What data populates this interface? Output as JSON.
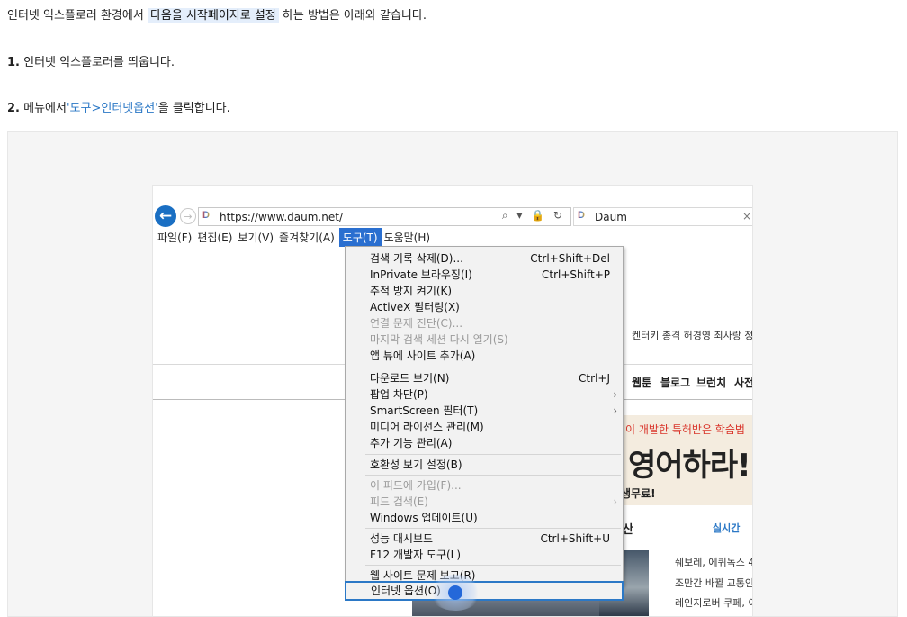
{
  "intro": {
    "before": "인터넷 익스플로러 환경에서",
    "highlight": "다음을 시작페이지로 설정",
    "after": "하는 방법은 아래와 같습니다."
  },
  "steps": [
    {
      "num": "1.",
      "text": "인터넷 익스플로러를 띄웁니다."
    },
    {
      "num": "2.",
      "text_before": "메뉴에서",
      "link": "'도구>인터넷옵션'",
      "text_after": "을 클릭합니다."
    }
  ],
  "browser": {
    "url": "https://www.daum.net/",
    "address_icons": "⌕ ▾ 🔒 ↻",
    "tab_title": "Daum",
    "tab_close": "×",
    "back_icon": "←",
    "forward_icon": "→",
    "menubar": [
      "파일(F)",
      "편집(E)",
      "보기(V)",
      "즐겨찾기(A)",
      "도구(T)",
      "도움말(H)"
    ],
    "active_menu": "도구(T)"
  },
  "tools_menu": {
    "items": [
      {
        "label": "검색 기록 삭제(D)...",
        "shortcut": "Ctrl+Shift+Del",
        "disabled": false
      },
      {
        "label": "InPrivate 브라우징(I)",
        "shortcut": "Ctrl+Shift+P",
        "disabled": false
      },
      {
        "label": "추적 방지 켜기(K)",
        "shortcut": "",
        "disabled": false
      },
      {
        "label": "ActiveX 필터링(X)",
        "shortcut": "",
        "disabled": false
      },
      {
        "label": "연결 문제 진단(C)...",
        "shortcut": "",
        "disabled": true
      },
      {
        "label": "마지막 검색 세션 다시 열기(S)",
        "shortcut": "",
        "disabled": true
      },
      {
        "label": "앱 뷰에 사이트 추가(A)",
        "shortcut": "",
        "disabled": false
      },
      {
        "label": "다운로드 보기(N)",
        "shortcut": "Ctrl+J",
        "disabled": false
      },
      {
        "label": "팝업 차단(P)",
        "shortcut": "",
        "submenu": "›",
        "disabled": false
      },
      {
        "label": "SmartScreen 필터(T)",
        "shortcut": "",
        "submenu": "›",
        "disabled": false
      },
      {
        "label": "미디어 라이선스 관리(M)",
        "shortcut": "",
        "disabled": false
      },
      {
        "label": "추가 기능 관리(A)",
        "shortcut": "",
        "disabled": false
      },
      {
        "label": "호환성 보기 설정(B)",
        "shortcut": "",
        "disabled": false
      },
      {
        "label": "이 피드에 가입(F)...",
        "shortcut": "",
        "disabled": true
      },
      {
        "label": "피드 검색(E)",
        "shortcut": "",
        "submenu": "›",
        "disabled": true
      },
      {
        "label": "Windows 업데이트(U)",
        "shortcut": "",
        "disabled": false
      },
      {
        "label": "성능 대시보드",
        "shortcut": "Ctrl+Shift+U",
        "disabled": false
      },
      {
        "label": "F12 개발자 도구(L)",
        "shortcut": "",
        "disabled": false
      },
      {
        "label": "웹 사이트 문제 보고(R)",
        "shortcut": "",
        "disabled": false
      },
      {
        "label": "인터넷 옵션(O)",
        "shortcut": "",
        "disabled": false,
        "selected": true
      }
    ]
  },
  "background_page": {
    "keywords": "켄터키 총격   허경영 최사랑   정",
    "nav": [
      "웹툰",
      "블로그",
      "브런치",
      "사전"
    ],
    "banner_top": "인이 개발한 특허받은 학습법",
    "banner_big": "영어하라!",
    "banner_small": "생무료!",
    "section_title": "산",
    "realtime": "실시간",
    "news": [
      "쉐보레, 에퀴녹스 4",
      "조만간 바뀔 교통인",
      "레인지로버 쿠페, 이"
    ]
  },
  "colors": {
    "link": "#2b78c6",
    "highlight_bg": "#e4eefb",
    "menu_active": "#2a6fd0"
  }
}
